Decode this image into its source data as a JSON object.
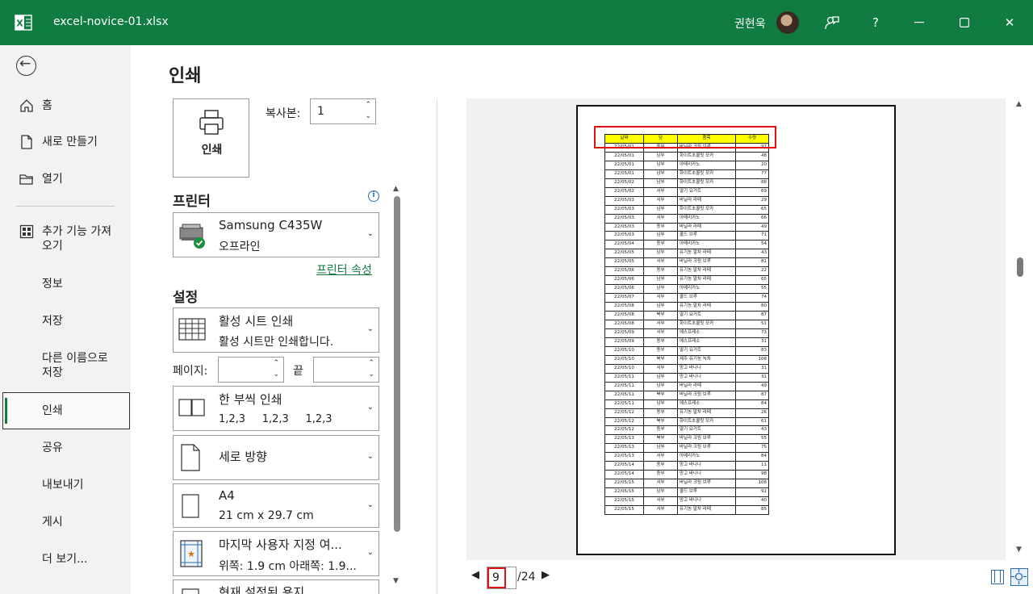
{
  "titlebar": {
    "filename": "excel-novice-01.xlsx",
    "user": "권현욱",
    "controls": [
      "feedback-icon",
      "help-icon",
      "minimize-icon",
      "maximize-icon",
      "close-icon"
    ],
    "help_label": "?",
    "close_label": "✕",
    "color": "#107c41"
  },
  "nav": {
    "items": [
      {
        "label": "홈",
        "icon": "home-icon"
      },
      {
        "label": "새로 만들기",
        "icon": "new-doc-icon"
      },
      {
        "label": "열기",
        "icon": "folder-icon"
      },
      {
        "label": "추가 기능 가져오기",
        "line1": "추가 기능 가져",
        "line2": "오기",
        "icon": "addins-icon"
      },
      {
        "label": "정보"
      },
      {
        "label": "저장"
      },
      {
        "label": "다른 이름으로 저장",
        "line1": "다른 이름으로",
        "line2": "저장"
      },
      {
        "label": "인쇄",
        "active": true
      },
      {
        "label": "공유"
      },
      {
        "label": "내보내기"
      },
      {
        "label": "게시"
      },
      {
        "label": "더 보기..."
      }
    ]
  },
  "main": {
    "title": "인쇄",
    "print_button": "인쇄",
    "copies_label": "복사본:",
    "copies_value": "1",
    "printer_heading": "프린터",
    "printer_name": "Samsung C435W",
    "printer_status": "오프라인",
    "printer_properties": "프린터 속성",
    "settings_heading": "설정",
    "settings": [
      {
        "line1": "활성 시트 인쇄",
        "line2": "활성 시트만 인쇄합니다.",
        "icon": "sheet-grid-icon"
      },
      {
        "line1": "한 부씩 인쇄",
        "line2": "1,2,3     1,2,3     1,2,3",
        "icon": "collate-icon"
      },
      {
        "line1": "세로 방향",
        "line2": "",
        "icon": "portrait-icon"
      },
      {
        "line1": "A4",
        "line2": "21 cm x 29.7 cm",
        "icon": "paper-size-icon"
      },
      {
        "line1": "마지막 사용자 지정 여...",
        "line2": "위쪽: 1.9 cm 아래쪽: 1.9...",
        "icon": "margins-icon"
      },
      {
        "line1": "현재 설정된 용지",
        "line2": "",
        "icon": "scaling-icon"
      }
    ],
    "pages_label": "페이지:",
    "pages_to_label": "끝",
    "pages_from": "",
    "pages_to": ""
  },
  "preview": {
    "current_page": "9",
    "total_pages": "/24",
    "headers": [
      "날짜",
      "담",
      "품목",
      "수량"
    ],
    "rows": [
      [
        "22/05/01",
        "동부",
        "바닐라 크림 브루",
        "97"
      ],
      [
        "22/05/01",
        "남부",
        "화이트초콜릿 모카",
        "48"
      ],
      [
        "22/05/01",
        "남부",
        "아메리카노",
        "20"
      ],
      [
        "22/05/01",
        "남부",
        "화이트초콜릿 모카",
        "77"
      ],
      [
        "22/05/02",
        "남부",
        "화이트초콜릿 모카",
        "88"
      ],
      [
        "22/05/02",
        "서부",
        "딸기 요거트",
        "69"
      ],
      [
        "22/05/03",
        "서부",
        "바닐라 라떼",
        "29"
      ],
      [
        "22/05/03",
        "남부",
        "화이트초콜릿 모카",
        "65"
      ],
      [
        "22/05/03",
        "서부",
        "아메리카노",
        "66"
      ],
      [
        "22/05/03",
        "동부",
        "바닐라 라떼",
        "49"
      ],
      [
        "22/05/03",
        "남부",
        "콜드 브루",
        "71"
      ],
      [
        "22/05/04",
        "동부",
        "아메리카노",
        "54"
      ],
      [
        "22/05/05",
        "남부",
        "유기농 말차 라떼",
        "43"
      ],
      [
        "22/05/05",
        "서부",
        "바닐라 크림 브루",
        "81"
      ],
      [
        "22/05/06",
        "동부",
        "유기농 말차 라떼",
        "22"
      ],
      [
        "22/05/06",
        "남부",
        "유기농 말차 라떼",
        "65"
      ],
      [
        "22/05/06",
        "남부",
        "아메리카노",
        "55"
      ],
      [
        "22/05/07",
        "서부",
        "콜드 브루",
        "74"
      ],
      [
        "22/05/08",
        "남부",
        "유기농 말차 라떼",
        "80"
      ],
      [
        "22/05/08",
        "북부",
        "딸기 요거트",
        "87"
      ],
      [
        "22/05/08",
        "서부",
        "화이트초콜릿 모카",
        "51"
      ],
      [
        "22/05/09",
        "서부",
        "에스프레소",
        "73"
      ],
      [
        "22/05/09",
        "동부",
        "에스프레소",
        "31"
      ],
      [
        "22/05/10",
        "동부",
        "딸기 요거트",
        "83"
      ],
      [
        "22/05/10",
        "북부",
        "제주 유기농 녹차",
        "108"
      ],
      [
        "22/05/10",
        "서부",
        "망고 바나나",
        "31"
      ],
      [
        "22/05/11",
        "남부",
        "망고 바나나",
        "31"
      ],
      [
        "22/05/11",
        "남부",
        "바닐라 라떼",
        "49"
      ],
      [
        "22/05/11",
        "북부",
        "바닐라 크림 브루",
        "87"
      ],
      [
        "22/05/11",
        "남부",
        "에스프레소",
        "84"
      ],
      [
        "22/05/12",
        "동부",
        "유기농 말차 라떼",
        "26"
      ],
      [
        "22/05/12",
        "북부",
        "화이트초콜릿 모카",
        "61"
      ],
      [
        "22/05/12",
        "동부",
        "딸기 요거트",
        "43"
      ],
      [
        "22/05/13",
        "북부",
        "바닐라 크림 브루",
        "55"
      ],
      [
        "22/05/13",
        "남부",
        "바닐라 크림 브루",
        "75"
      ],
      [
        "22/05/13",
        "서부",
        "아메리카노",
        "84"
      ],
      [
        "22/05/14",
        "동부",
        "망고 바나나",
        "11"
      ],
      [
        "22/05/14",
        "동부",
        "망고 바나나",
        "98"
      ],
      [
        "22/05/15",
        "서부",
        "바닐라 크림 브루",
        "108"
      ],
      [
        "22/05/15",
        "남부",
        "콜드 브루",
        "92"
      ],
      [
        "22/05/15",
        "서부",
        "망고 바나나",
        "40"
      ],
      [
        "22/05/15",
        "서부",
        "유기농 말차 라떼",
        "85"
      ]
    ]
  }
}
